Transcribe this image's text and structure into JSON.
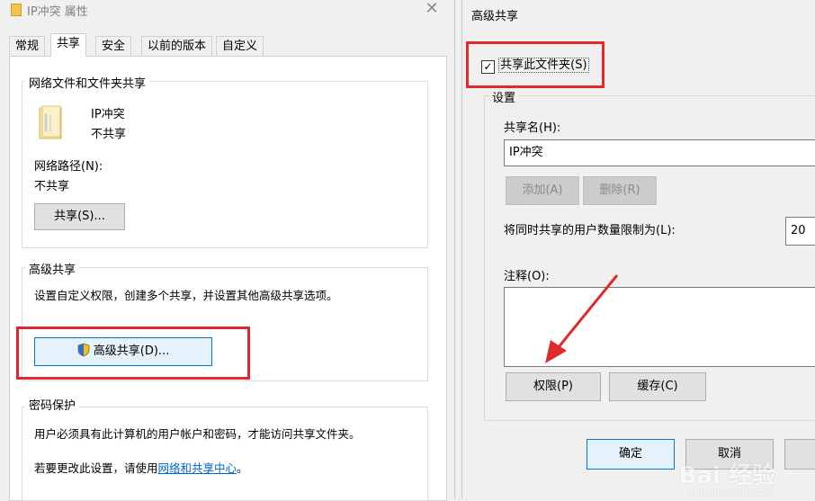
{
  "props_window": {
    "title": "IP冲突 属性",
    "tabs": [
      "常规",
      "共享",
      "安全",
      "以前的版本",
      "自定义"
    ],
    "network_share": {
      "group_title": "网络文件和文件夹共享",
      "folder_name": "IP冲突",
      "share_status": "不共享",
      "network_path_label": "网络路径(N):",
      "network_path_value": "不共享",
      "share_button": "共享(S)..."
    },
    "advanced_share": {
      "group_title": "高级共享",
      "description": "设置自定义权限，创建多个共享，并设置其他高级共享选项。",
      "button": "高级共享(D)..."
    },
    "password_protection": {
      "group_title": "密码保护",
      "description": "用户必须具有此计算机的用户帐户和密码，才能访问共享文件夹。",
      "change_prefix": "若要更改此设置，请使用",
      "change_link": "网络和共享中心",
      "change_suffix": "。"
    }
  },
  "adv_dialog": {
    "title": "高级共享",
    "share_checkbox_label": "共享此文件夹(S)",
    "share_checkbox_checked": true,
    "settings_group_title": "设置",
    "share_name_label": "共享名(H):",
    "share_name_value": "IP冲突",
    "add_button": "添加(A)",
    "remove_button": "删除(R)",
    "user_limit_label": "将同时共享的用户数量限制为(L):",
    "user_limit_value": "20",
    "comments_label": "注释(O):",
    "permissions_button": "权限(P)",
    "caching_button": "缓存(C)",
    "ok_button": "确定",
    "cancel_button": "取消"
  },
  "watermark": {
    "text": "Bai 经验",
    "sub": "jingyan.baidu.com"
  },
  "colors": {
    "highlight_red": "#e02a2a",
    "accent_blue": "#0078d7",
    "link_blue": "#0066cc"
  }
}
